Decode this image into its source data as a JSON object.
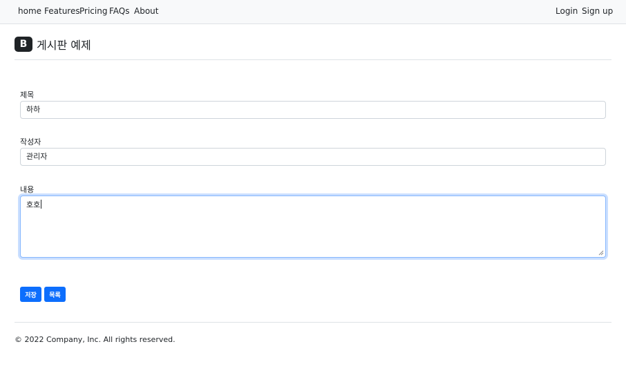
{
  "nav": {
    "left": [
      "home",
      "Features",
      "Pricing",
      "FAQs",
      "About"
    ],
    "right": [
      "Login",
      "Sign up"
    ]
  },
  "brand": {
    "logo_letter": "B",
    "title": "게시판 예제"
  },
  "form": {
    "title_label": "제목",
    "title_value": "하하",
    "writer_label": "작성자",
    "writer_value": "관리자",
    "content_label": "내용",
    "content_value": "호호"
  },
  "buttons": {
    "save": "저장",
    "list": "목록"
  },
  "footer": {
    "text": "© 2022 Company, Inc. All rights reserved."
  },
  "colors": {
    "accent": "#0d6efd",
    "focus_border": "#86b7fe",
    "nav_bg": "#f8f9fa"
  }
}
